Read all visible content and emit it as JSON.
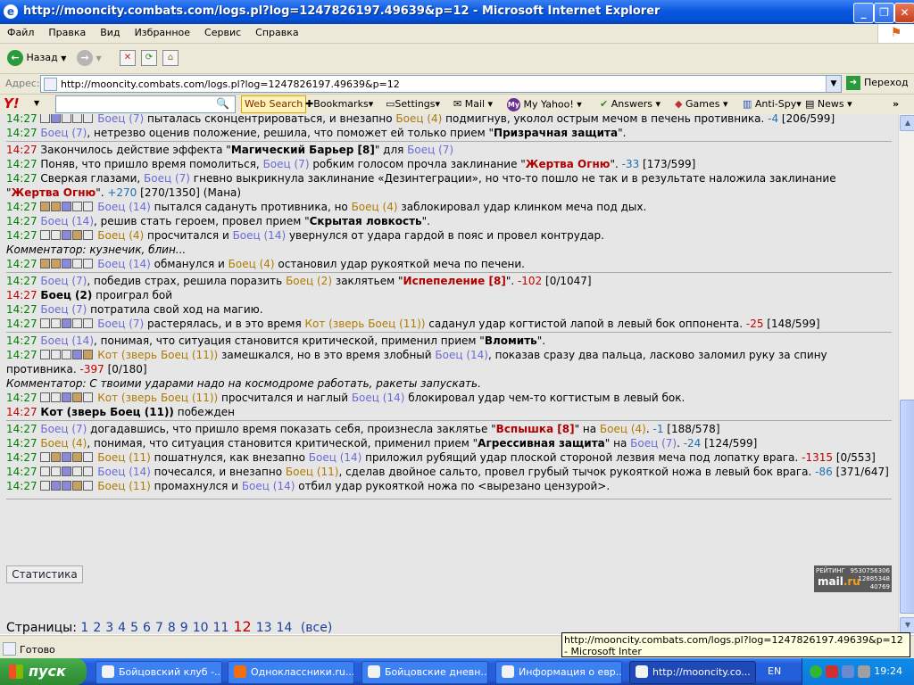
{
  "window": {
    "title": "http://mooncity.combats.com/logs.pl?log=1247826197.49639&p=12 - Microsoft Internet Explorer",
    "min": "_",
    "max": "❐",
    "close": "✕"
  },
  "menu": [
    "Файл",
    "Правка",
    "Вид",
    "Избранное",
    "Сервис",
    "Справка"
  ],
  "toolbar": {
    "back": "Назад",
    "fwd_icon": "→",
    "stop_icon": "✕",
    "refresh_icon": "⟳",
    "home_icon": "⌂"
  },
  "address": {
    "label": "Адрес:",
    "url": "http://mooncity.combats.com/logs.pl?log=1247826197.49639&p=12",
    "go": "Переход"
  },
  "yahoo": {
    "logo": "Y!",
    "web_search": "Web Search",
    "bookmarks": "Bookmarks",
    "settings": "Settings",
    "mail": "Mail",
    "myyahoo": "My Yahoo!",
    "answers": "Answers",
    "games": "Games",
    "antispy": "Anti-Spy",
    "news": "News",
    "more": "»"
  },
  "log": {
    "l1": {
      "t": "14:27",
      "b1": "Боец (7)",
      "x1": " пыталась сконцентрироваться, и внезапно ",
      "b2": "Боец (4)",
      "x2": " подмигнув, уколол острым мечом в печень противника. ",
      "n": "-4",
      "x3": " [206/599]"
    },
    "l2": {
      "t": "14:27",
      "b1": "Боец (7)",
      "x1": ", нетрезво оценив положение, решила, что поможет ей только прием \"",
      "bold": "Призрачная защита",
      "x2": "\"."
    },
    "l3": {
      "t": "14:27",
      "x1": " Закончилось действие эффекта \"",
      "bold": "Магический Барьер [8]",
      "x2": "\" для ",
      "b1": "Боец (7)"
    },
    "l4": {
      "t": "14:27",
      "x1": " Поняв, что пришло время помолиться, ",
      "b1": "Боец (7)",
      "x2": " робким голосом прочла заклинание \"",
      "sp": "Жертва Огню",
      "x3": "\". ",
      "n": "-33",
      "x4": " [173/599]"
    },
    "l5": {
      "t": "14:27",
      "x1": " Сверкая глазами, ",
      "b1": "Боец (7)",
      "x2": " гневно выкрикнула заклинание «Дезинтеграции», но что-то пошло не так и в результате наложила заклинание \"",
      "sp": "Жертва Огню",
      "x3": "\". ",
      "n": "+270",
      "x4": " [270/1350] (Мана)"
    },
    "l6": {
      "t": "14:27",
      "b1": "Боец (14)",
      "x1": " пытался садануть противника, но ",
      "b2": "Боец (4)",
      "x2": " заблокировал удар клинком меча под дых."
    },
    "l7": {
      "t": "14:27",
      "b1": "Боец (14)",
      "x1": ", решив стать героем, провел прием \"",
      "bold": "Скрытая ловкость",
      "x2": "\"."
    },
    "l8": {
      "t": "14:27",
      "b2": "Боец (4)",
      "x1": " просчитался и ",
      "b1": "Боец (14)",
      "x2": " увернулся от удара гардой в пояс и провел контрудар."
    },
    "c1": "Комментатор: кузнечик, блин...",
    "l9": {
      "t": "14:27",
      "b1": "Боец (14)",
      "x1": " обманулся и ",
      "b2": "Боец (4)",
      "x2": " остановил удар рукояткой меча по печени."
    },
    "l10": {
      "t": "14:27",
      "b1": "Боец (7)",
      "x1": ", победив страх, решила поразить ",
      "b2": "Боец (2)",
      "x2": " заклятьем \"",
      "sp": "Испепеление [8]",
      "x3": "\". ",
      "n": "-102",
      "x4": " [0/1047]"
    },
    "l11": {
      "t": "14:27",
      "bold": "Боец (2)",
      "x1": " проиграл бой"
    },
    "l12": {
      "t": "14:27",
      "b1": "Боец (7)",
      "x1": " потратила свой ход на магию."
    },
    "l13": {
      "t": "14:27",
      "b1": "Боец (7)",
      "x1": " растерялась, и в это время ",
      "b2": "Кот (зверь Боец (11))",
      "x2": " саданул удар когтистой лапой в левый бок оппонента. ",
      "n": "-25",
      "x3": " [148/599]"
    },
    "l14": {
      "t": "14:27",
      "b1": "Боец (14)",
      "x1": ", понимая, что ситуация становится критической, применил прием \"",
      "bold": "Вломить",
      "x2": "\"."
    },
    "l15": {
      "t": "14:27",
      "b2": "Кот (зверь Боец (11))",
      "x1": " замешкался, но в это время злобный ",
      "b1": "Боец (14)",
      "x2": ", показав сразу два пальца, ласково заломил руку за спину противника. ",
      "n": "-397",
      "x3": " [0/180]"
    },
    "c2": "Комментатор: С твоими ударами надо на космодроме работать, ракеты запускать.",
    "l16": {
      "t": "14:27",
      "b2": "Кот (зверь Боец (11))",
      "x1": " просчитался и наглый ",
      "b1": "Боец (14)",
      "x2": " блокировал удар чем-то когтистым в левый бок."
    },
    "l17": {
      "t": "14:27",
      "bold": "Кот (зверь Боец (11))",
      "x1": " побежден"
    },
    "l18": {
      "t": "14:27",
      "b1": "Боец (7)",
      "x1": " догадавшись, что пришло время показать себя, произнесла заклятье \"",
      "sp": "Вспышка [8]",
      "x2": "\" на ",
      "b2": "Боец (4)",
      "x3": ". ",
      "n": "-1",
      "x4": " [188/578]"
    },
    "l19": {
      "t": "14:27",
      "b2": "Боец (4)",
      "x1": ", понимая, что ситуация становится критической, применил прием \"",
      "bold": "Агрессивная защита",
      "x2": "\" на ",
      "b1": "Боец (7)",
      "x3": ". ",
      "n": "-24",
      "x4": " [124/599]"
    },
    "l20": {
      "t": "14:27",
      "b2": "Боец (11)",
      "x1": " пошатнулся, как внезапно ",
      "b1": "Боец (14)",
      "x2": " приложил рубящий удар плоской стороной лезвия меча под лопатку врага. ",
      "n": "-1315",
      "x3": " [0/553]"
    },
    "l21": {
      "t": "14:27",
      "b1": "Боец (14)",
      "x1": " почесался, и внезапно ",
      "b2": "Боец (11)",
      "x2": ", сделав двойное сальто, провел грубый тычок рукояткой ножа в левый бок врага. ",
      "n": "-86",
      "x3": " [371/647]"
    },
    "l22": {
      "t": "14:27",
      "b2": "Боец (11)",
      "x1": " промахнулся и ",
      "b1": "Боец (14)",
      "x2": " отбил удар рукояткой ножа по <вырезано цензурой>."
    }
  },
  "stats_button": "Статистика",
  "mailru": {
    "rating": "РЕЙТИНГ",
    "n1": "9530756306",
    "n2": "12885348",
    "n3": "40769",
    "logo_a": "mail",
    "logo_b": ".ru"
  },
  "pages": {
    "label": "Страницы:",
    "list": [
      "1",
      "2",
      "3",
      "4",
      "5",
      "6",
      "7",
      "8",
      "9",
      "10",
      "11"
    ],
    "current": "12",
    "after": [
      "13",
      "14"
    ],
    "all": "(все)"
  },
  "status": {
    "text": "Готово"
  },
  "tooltip": "http://mooncity.combats.com/logs.pl?log=1247826197.49639&p=12 - Microsoft Inter",
  "taskbar": {
    "start": "пуск",
    "tasks": [
      "Бойцовский клуб -...",
      "Одноклассники.ru...",
      "Бойцовские дневн...",
      "Информация о евр...",
      "http://mooncity.co..."
    ],
    "lang": "EN",
    "clock": "19:24"
  }
}
